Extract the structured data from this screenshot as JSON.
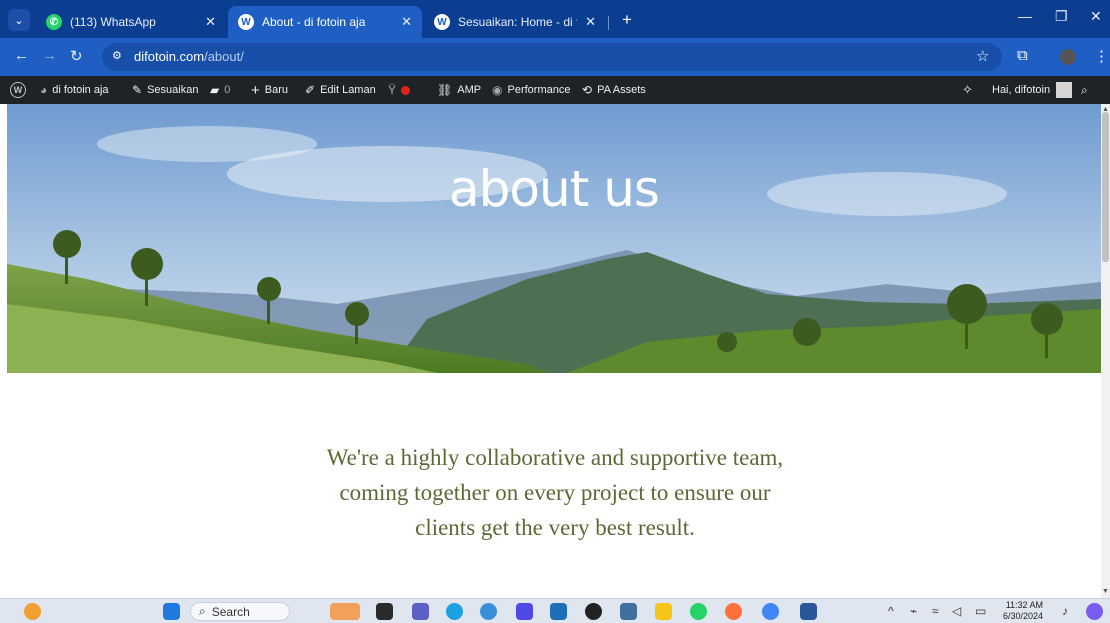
{
  "browser": {
    "tabs": [
      {
        "title": "(113) WhatsApp",
        "icon": "whatsapp-icon",
        "active": false
      },
      {
        "title": "About - di fotoin aja",
        "icon": "wordpress-icon",
        "active": true
      },
      {
        "title": "Sesuaikan: Home - di fotoin aja",
        "icon": "wordpress-icon",
        "active": false
      }
    ],
    "url_domain": "difotoin.com",
    "url_path": "/about/"
  },
  "adminbar": {
    "site_name": "di fotoin aja",
    "customize": "Sesuaikan",
    "comments_count": "0",
    "new": "Baru",
    "edit_page": "Edit Laman",
    "amp": "AMP",
    "performance": "Performance",
    "pa_assets": "PA Assets",
    "greeting": "Hai, difotoin"
  },
  "page": {
    "hero_title": "about us",
    "intro_line1": "We're a highly collaborative and supportive team,",
    "intro_line2": "coming together on every project to ensure our",
    "intro_line3": "clients get the very best result."
  },
  "taskbar": {
    "search_placeholder": "Search",
    "time": "11:32 AM",
    "date": "6/30/2024"
  },
  "colors": {
    "tabstrip": "#0b3d91",
    "toolbar": "#1f5fc4",
    "adminbar": "#1d2327",
    "intro_text": "#5a6a35"
  }
}
